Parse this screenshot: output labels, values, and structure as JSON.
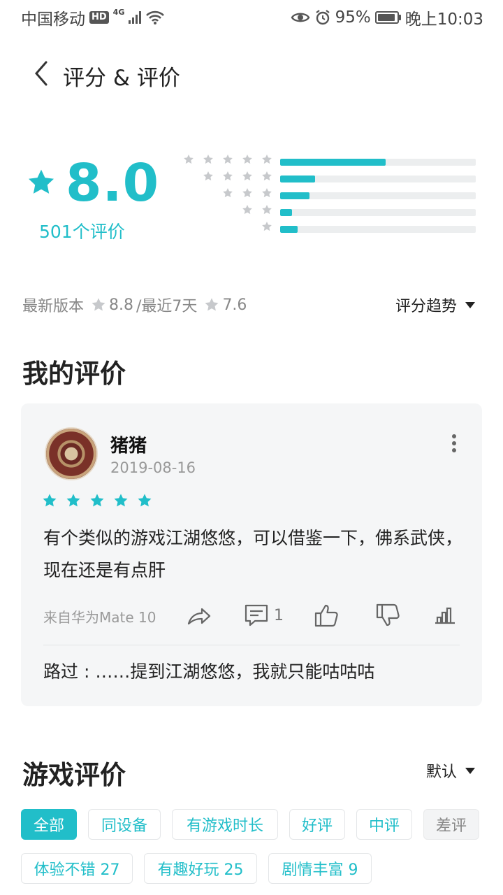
{
  "status_bar": {
    "carrier": "中国移动",
    "hd": "HD",
    "network": "4G",
    "battery": "95%",
    "time": "晚上10:03"
  },
  "header": {
    "title": "评分 & 评价",
    "back_icon": "chevron-left-icon"
  },
  "summary": {
    "score": "8.0",
    "count": "501个评价",
    "distribution": [
      {
        "stars": 5,
        "fraction": 0.54
      },
      {
        "stars": 4,
        "fraction": 0.18
      },
      {
        "stars": 3,
        "fraction": 0.15
      },
      {
        "stars": 2,
        "fraction": 0.06
      },
      {
        "stars": 1,
        "fraction": 0.09
      }
    ],
    "latest_version_label": "最新版本",
    "latest_version_score": "8.8",
    "recent_label": "/最近7天",
    "recent_score": "7.6",
    "trend_label": "评分趋势"
  },
  "my_review": {
    "section_title": "我的评价",
    "user": "猪猪",
    "date": "2019-08-16",
    "stars": 5,
    "text": "有个类似的游戏江湖悠悠，可以借鉴一下，佛系武侠，现在还是有点肝",
    "device": "来自华为Mate 10",
    "comment_count": "1",
    "reply": "路过 : ……提到江湖悠悠，我就只能咕咕咕"
  },
  "game_reviews": {
    "section_title": "游戏评价",
    "sort_label": "默认",
    "filters": [
      "全部",
      "同设备",
      "有游戏时长",
      "好评",
      "中评",
      "差评"
    ],
    "tags": [
      "体验不错 27",
      "有趣好玩 25",
      "剧情丰富 9"
    ]
  },
  "colors": {
    "accent": "#21bec9",
    "star_gray": "#c7c9cc"
  }
}
